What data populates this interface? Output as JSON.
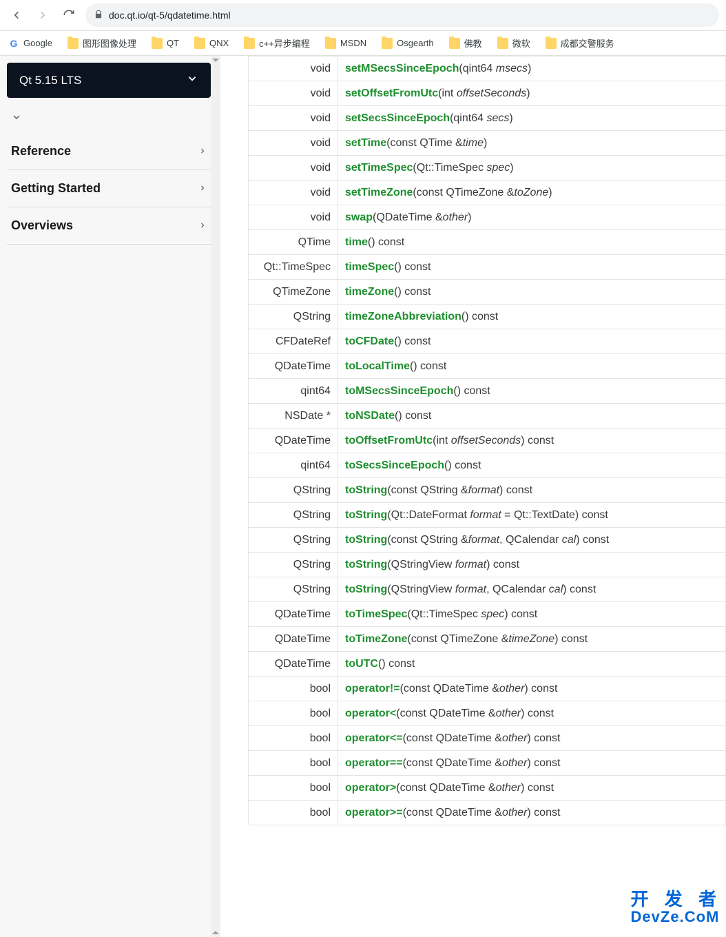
{
  "browser": {
    "url": "doc.qt.io/qt-5/qdatetime.html"
  },
  "bookmarks": [
    {
      "label": "Google",
      "icon": "g"
    },
    {
      "label": "图形图像处理",
      "icon": "f"
    },
    {
      "label": "QT",
      "icon": "f"
    },
    {
      "label": "QNX",
      "icon": "f"
    },
    {
      "label": "c++异步编程",
      "icon": "f"
    },
    {
      "label": "MSDN",
      "icon": "f"
    },
    {
      "label": "Osgearth",
      "icon": "f"
    },
    {
      "label": "佛教",
      "icon": "f"
    },
    {
      "label": "微软",
      "icon": "f"
    },
    {
      "label": "成都交警服务",
      "icon": "f"
    }
  ],
  "sidebar": {
    "version": "Qt 5.15 LTS",
    "items": [
      {
        "label": "Reference"
      },
      {
        "label": "Getting Started"
      },
      {
        "label": "Overviews"
      }
    ]
  },
  "methods": [
    {
      "ret": "void",
      "fn": "setMSecsSinceEpoch",
      "sig": "(qint64 ",
      "it": "msecs",
      "tail": ")"
    },
    {
      "ret": "void",
      "fn": "setOffsetFromUtc",
      "sig": "(int ",
      "it": "offsetSeconds",
      "tail": ")"
    },
    {
      "ret": "void",
      "fn": "setSecsSinceEpoch",
      "sig": "(qint64 ",
      "it": "secs",
      "tail": ")"
    },
    {
      "ret": "void",
      "fn": "setTime",
      "sig": "(const QTime &",
      "it": "time",
      "tail": ")"
    },
    {
      "ret": "void",
      "fn": "setTimeSpec",
      "sig": "(Qt::TimeSpec ",
      "it": "spec",
      "tail": ")"
    },
    {
      "ret": "void",
      "fn": "setTimeZone",
      "sig": "(const QTimeZone &",
      "it": "toZone",
      "tail": ")"
    },
    {
      "ret": "void",
      "fn": "swap",
      "sig": "(QDateTime &",
      "it": "other",
      "tail": ")"
    },
    {
      "ret": "QTime",
      "fn": "time",
      "sig": "() const",
      "it": "",
      "tail": ""
    },
    {
      "ret": "Qt::TimeSpec",
      "fn": "timeSpec",
      "sig": "() const",
      "it": "",
      "tail": ""
    },
    {
      "ret": "QTimeZone",
      "fn": "timeZone",
      "sig": "() const",
      "it": "",
      "tail": ""
    },
    {
      "ret": "QString",
      "fn": "timeZoneAbbreviation",
      "sig": "() const",
      "it": "",
      "tail": ""
    },
    {
      "ret": "CFDateRef",
      "fn": "toCFDate",
      "sig": "() const",
      "it": "",
      "tail": ""
    },
    {
      "ret": "QDateTime",
      "fn": "toLocalTime",
      "sig": "() const",
      "it": "",
      "tail": ""
    },
    {
      "ret": "qint64",
      "fn": "toMSecsSinceEpoch",
      "sig": "() const",
      "it": "",
      "tail": ""
    },
    {
      "ret": "NSDate *",
      "fn": "toNSDate",
      "sig": "() const",
      "it": "",
      "tail": ""
    },
    {
      "ret": "QDateTime",
      "fn": "toOffsetFromUtc",
      "sig": "(int ",
      "it": "offsetSeconds",
      "tail": ") const"
    },
    {
      "ret": "qint64",
      "fn": "toSecsSinceEpoch",
      "sig": "() const",
      "it": "",
      "tail": ""
    },
    {
      "ret": "QString",
      "fn": "toString",
      "sig": "(const QString &",
      "it": "format",
      "tail": ") const"
    },
    {
      "ret": "QString",
      "fn": "toString",
      "sig": "(Qt::DateFormat ",
      "it": "format",
      "tail": " = Qt::TextDate) const"
    },
    {
      "ret": "QString",
      "fn": "toString",
      "sig": "(const QString &",
      "it": "format",
      "tail": ", QCalendar ",
      "it2": "cal",
      "tail2": ") const"
    },
    {
      "ret": "QString",
      "fn": "toString",
      "sig": "(QStringView ",
      "it": "format",
      "tail": ") const"
    },
    {
      "ret": "QString",
      "fn": "toString",
      "sig": "(QStringView ",
      "it": "format",
      "tail": ", QCalendar ",
      "it2": "cal",
      "tail2": ") const"
    },
    {
      "ret": "QDateTime",
      "fn": "toTimeSpec",
      "sig": "(Qt::TimeSpec ",
      "it": "spec",
      "tail": ") const"
    },
    {
      "ret": "QDateTime",
      "fn": "toTimeZone",
      "sig": "(const QTimeZone &",
      "it": "timeZone",
      "tail": ") const"
    },
    {
      "ret": "QDateTime",
      "fn": "toUTC",
      "sig": "() const",
      "it": "",
      "tail": ""
    },
    {
      "ret": "bool",
      "fn": "operator!=",
      "sig": "(const QDateTime &",
      "it": "other",
      "tail": ") const"
    },
    {
      "ret": "bool",
      "fn": "operator<",
      "sig": "(const QDateTime &",
      "it": "other",
      "tail": ") const"
    },
    {
      "ret": "bool",
      "fn": "operator<=",
      "sig": "(const QDateTime &",
      "it": "other",
      "tail": ") const"
    },
    {
      "ret": "bool",
      "fn": "operator==",
      "sig": "(const QDateTime &",
      "it": "other",
      "tail": ") const"
    },
    {
      "ret": "bool",
      "fn": "operator>",
      "sig": "(const QDateTime &",
      "it": "other",
      "tail": ") const"
    },
    {
      "ret": "bool",
      "fn": "operator>=",
      "sig": "(const QDateTime &",
      "it": "other",
      "tail": ") const"
    }
  ],
  "watermark": {
    "line1": "开 发 者",
    "line2": "DevZe.CoM"
  }
}
